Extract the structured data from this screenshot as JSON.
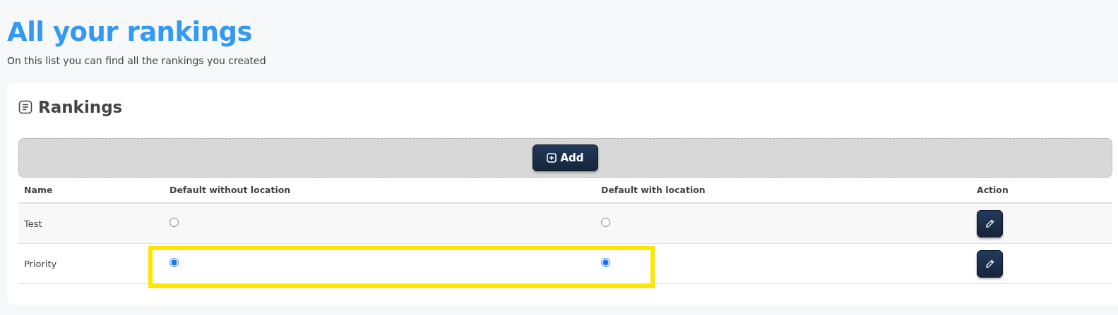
{
  "page": {
    "title": "All your rankings",
    "subtitle": "On this list you can find all the rankings you created"
  },
  "card": {
    "title": "Rankings",
    "add_button": "Add"
  },
  "table": {
    "columns": [
      "Name",
      "Default without location",
      "Default with location",
      "Action"
    ],
    "rows": [
      {
        "name": "Test",
        "default_without_location": false,
        "default_with_location": false,
        "highlighted": false
      },
      {
        "name": "Priority",
        "default_without_location": true,
        "default_with_location": true,
        "highlighted": true
      }
    ]
  }
}
